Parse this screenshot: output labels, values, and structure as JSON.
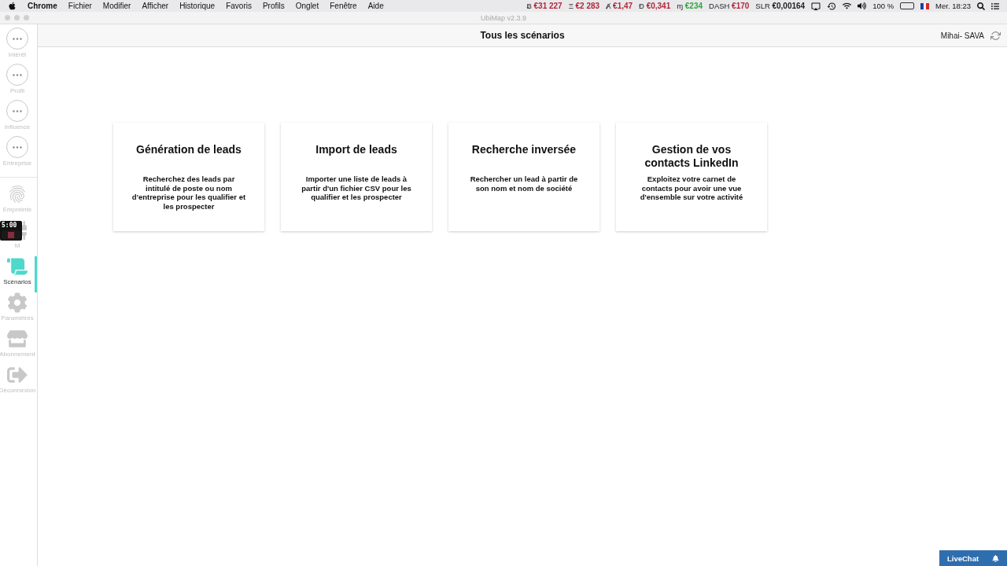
{
  "menu_bar": {
    "app": "Chrome",
    "menus": [
      "Fichier",
      "Modifier",
      "Afficher",
      "Historique",
      "Favoris",
      "Profils",
      "Onglet",
      "Fenêtre",
      "Aide"
    ],
    "tickers": [
      {
        "symbol": "Ƀ",
        "value": "€31 227",
        "color": "#b0283a"
      },
      {
        "symbol": "Ξ",
        "value": "€2 283",
        "color": "#b0283a"
      },
      {
        "symbol": "Ⱥ",
        "value": "€1,47",
        "color": "#b0283a"
      },
      {
        "symbol": "Ð",
        "value": "€0,341",
        "color": "#b0283a"
      },
      {
        "symbol": "ɱ",
        "value": "€234",
        "color": "#2fa83a"
      },
      {
        "symbol": "DASH",
        "value": "€170",
        "color": "#b0283a"
      },
      {
        "symbol": "SLR",
        "value": "€0,00164",
        "color": "#222222"
      }
    ],
    "battery": "100 %",
    "clock": "Mer. 18:23"
  },
  "window": {
    "title": "UbiMap v2.3.9"
  },
  "header": {
    "title": "Tous les scénarios",
    "user": "Mihai- SAVA"
  },
  "sidebar": {
    "items": [
      {
        "kind": "circle",
        "label": "Intérêt",
        "selected": false
      },
      {
        "kind": "circle",
        "label": "Profil",
        "selected": false
      },
      {
        "kind": "circle",
        "label": "Influence",
        "selected": false
      },
      {
        "kind": "circle",
        "label": "Entreprise",
        "selected": false
      },
      {
        "kind": "fingerprint",
        "label": "Empreinte",
        "selected": false
      },
      {
        "kind": "crm",
        "label": "M",
        "selected": false
      },
      {
        "kind": "scroll",
        "label": "Scénarios",
        "selected": true
      },
      {
        "kind": "gear",
        "label": "Paramètres",
        "selected": false
      },
      {
        "kind": "store",
        "label": "Abonnement",
        "selected": false
      },
      {
        "kind": "logout",
        "label": "Déconnexion",
        "selected": false
      }
    ]
  },
  "recorder": {
    "time": "5:00"
  },
  "cards": [
    {
      "title": "Génération de leads",
      "description": "Recherchez des leads par intitulé de poste ou nom d'entreprise pour les qualifier et les prospecter"
    },
    {
      "title": "Import de leads",
      "description": "Importer une liste de leads à partir d'un fichier CSV pour les qualifier et les prospecter"
    },
    {
      "title": "Recherche inversée",
      "description": "Rechercher un lead à partir de son nom et nom de société"
    },
    {
      "title": "Gestion de vos contacts LinkedIn",
      "description": "Exploitez votre carnet de contacts pour avoir une vue d'ensemble sur votre activité"
    }
  ],
  "livechat": {
    "label": "LiveChat"
  }
}
